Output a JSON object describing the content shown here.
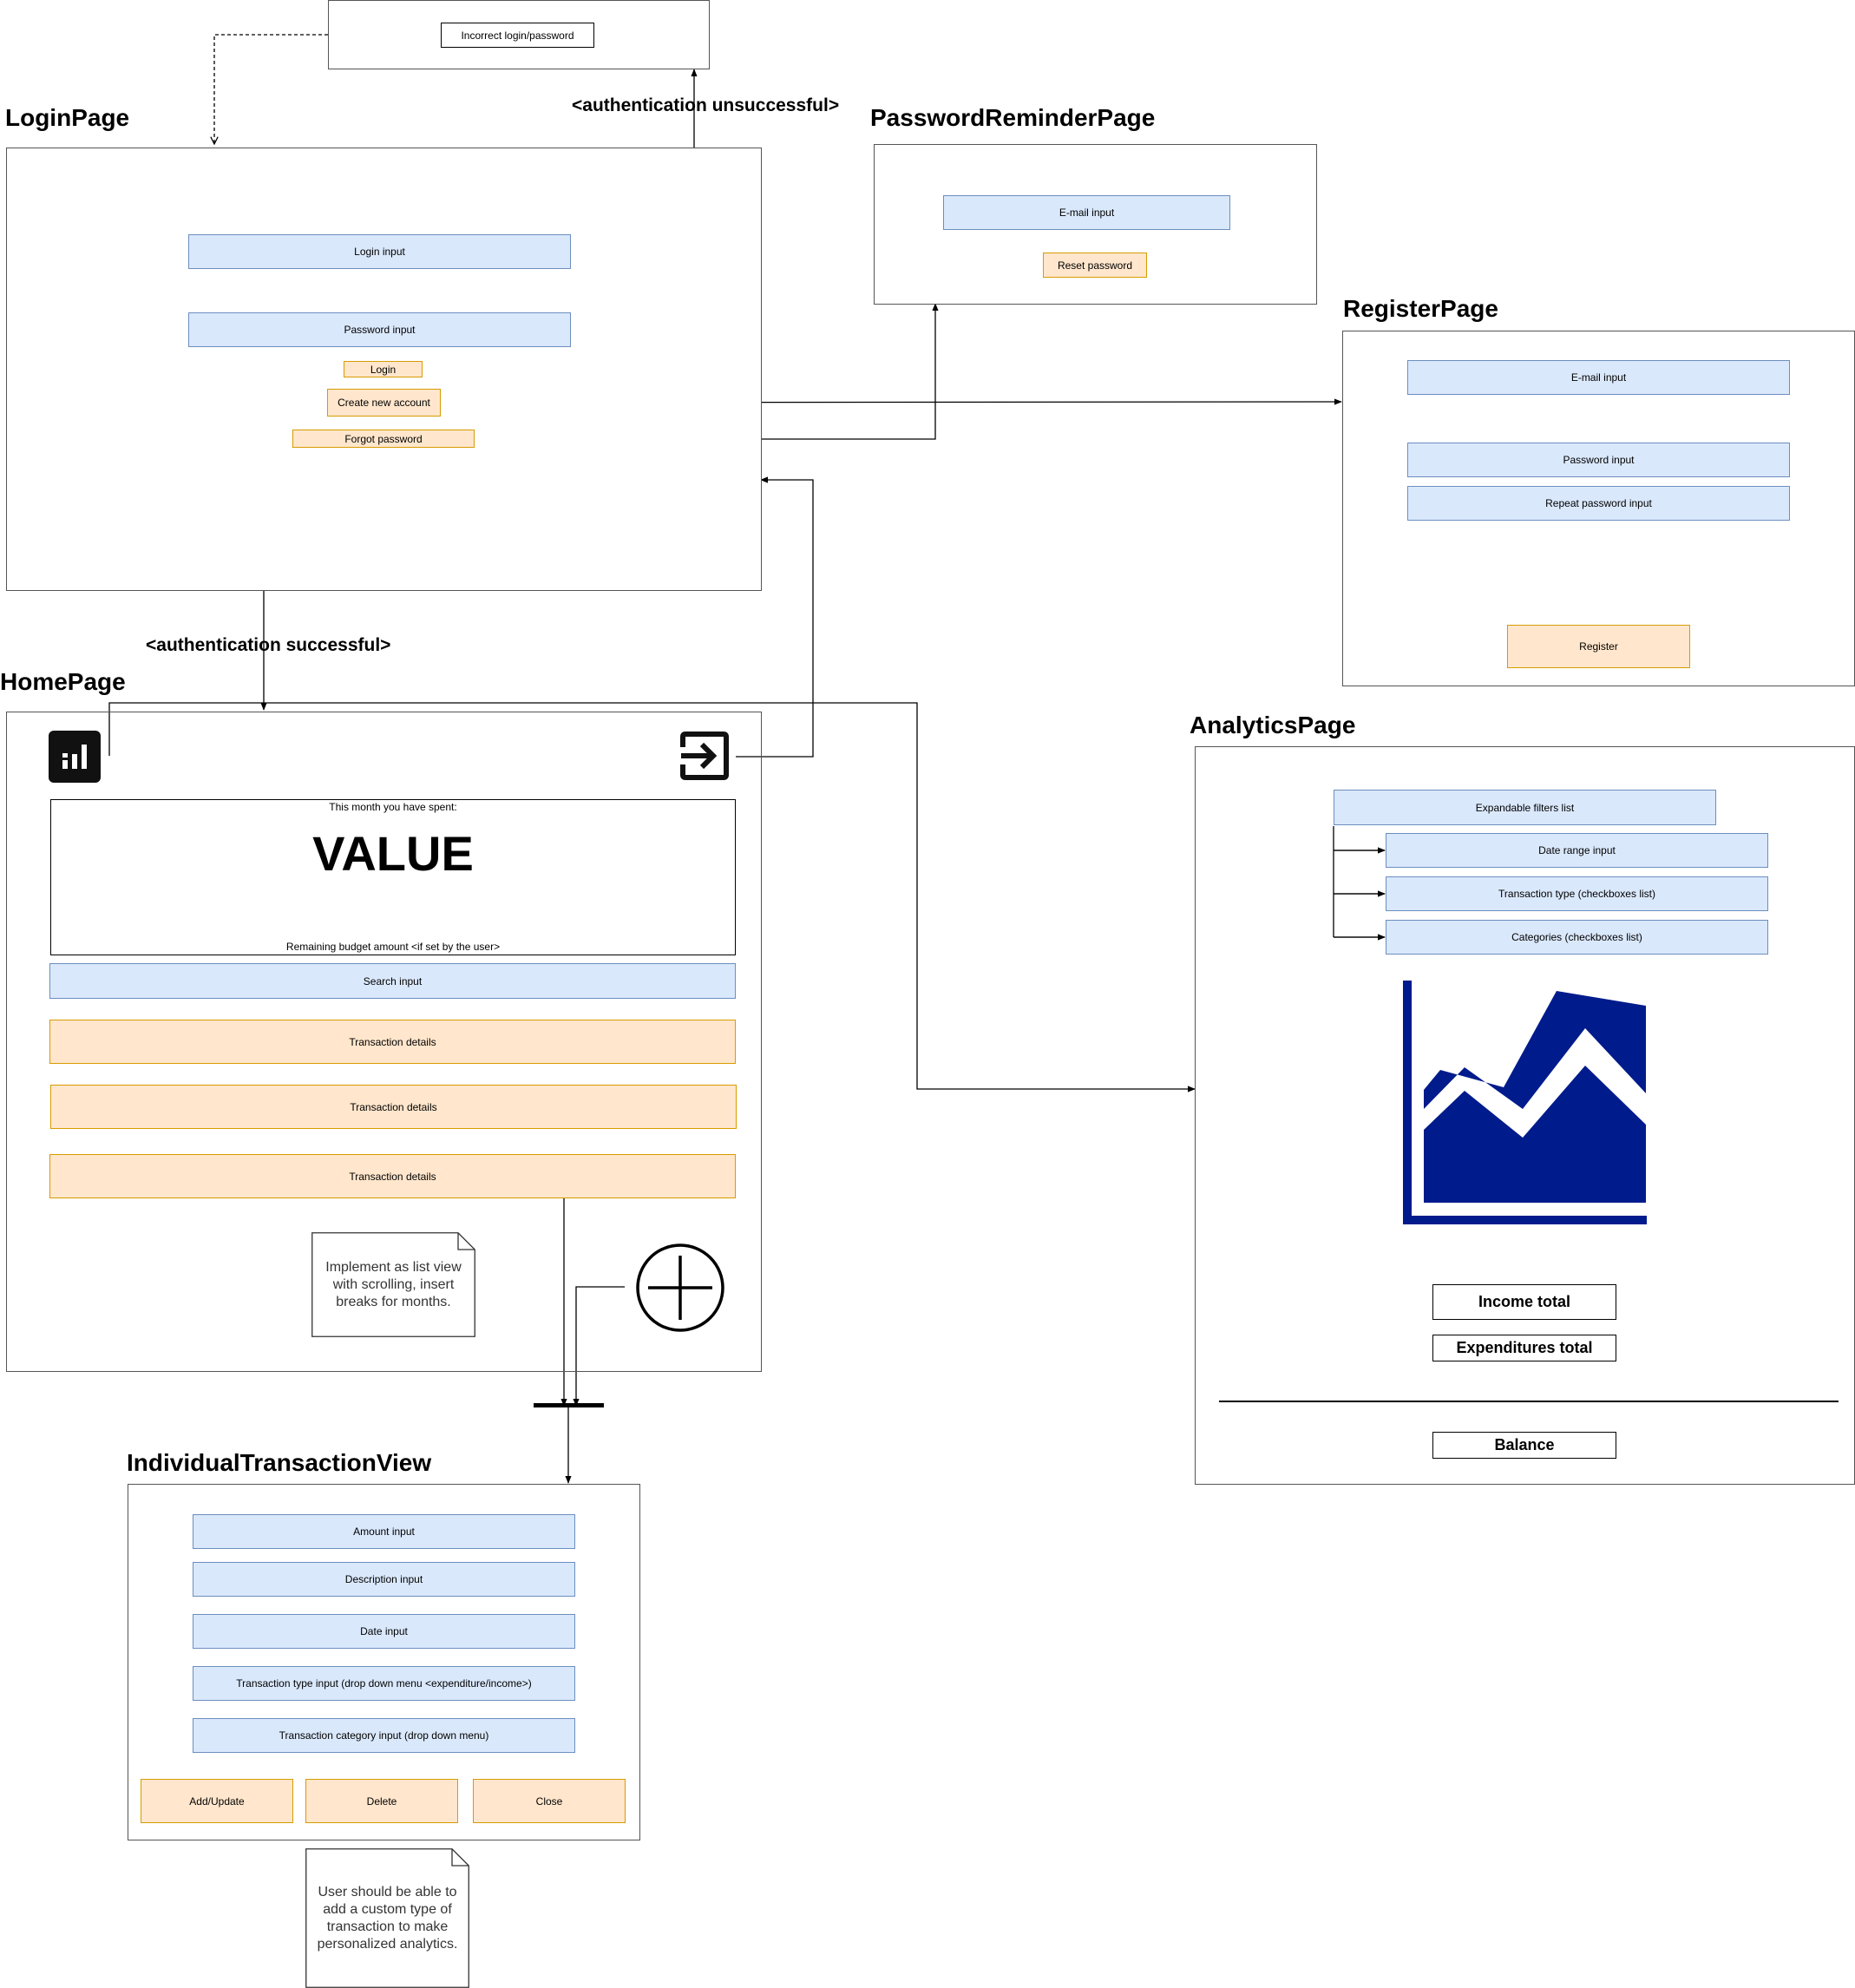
{
  "pages": {
    "login": "LoginPage",
    "password_reminder": "PasswordReminderPage",
    "register": "RegisterPage",
    "home": "HomePage",
    "analytics": "AnalyticsPage",
    "transaction": "IndividualTransactionView"
  },
  "error_popup": {
    "message": "Incorrect login/password"
  },
  "edge_labels": {
    "auth_fail": "<authentication unsuccessful>",
    "auth_ok": "<authentication successful>"
  },
  "login": {
    "login_input": "Login input",
    "password_input": "Password input",
    "login_button": "Login",
    "create_account": "Create new account",
    "forgot_password": "Forgot password"
  },
  "password_reminder": {
    "email_input": "E-mail input",
    "reset_button": "Reset password"
  },
  "register": {
    "email_input": "E-mail input",
    "password_input": "Password input",
    "repeat_password_input": "Repeat password input",
    "register_button": "Register"
  },
  "home": {
    "spent_caption": "This month you have spent:",
    "value": "VALUE",
    "remaining": "Remaining budget amount <if set by the user>",
    "search_input": "Search input",
    "transactions": [
      "Transaction details",
      "Transaction details",
      "Transaction details"
    ],
    "note": "Implement as list view with scrolling, insert breaks for months.",
    "icons": [
      "analytics-icon",
      "logout-icon",
      "add-transaction-icon"
    ]
  },
  "analytics": {
    "filters_list": "Expandable filters list",
    "filters": [
      "Date range input",
      "Transaction type (checkboxes list)",
      "Categories (checkboxes list)"
    ],
    "chart_icon": "area-chart-icon",
    "income_total": "Income total",
    "expenditures_total": "Expenditures total",
    "balance": "Balance",
    "colors": {
      "chart": "#001b8c"
    }
  },
  "transaction": {
    "amount_input": "Amount input",
    "description_input": "Description input",
    "date_input": "Date input",
    "type_input": "Transaction type input (drop down menu <expenditure/income>)",
    "category_input": "Transaction category input (drop down menu)",
    "add_update": "Add/Update",
    "delete": "Delete",
    "close": "Close",
    "note": "User should be able to add a custom type of transaction to make personalized analytics."
  },
  "colors": {
    "input_fill": "#dae8fc",
    "input_border": "#6c8ebf",
    "button_fill": "#ffe6cc",
    "button_border": "#d79b00"
  }
}
